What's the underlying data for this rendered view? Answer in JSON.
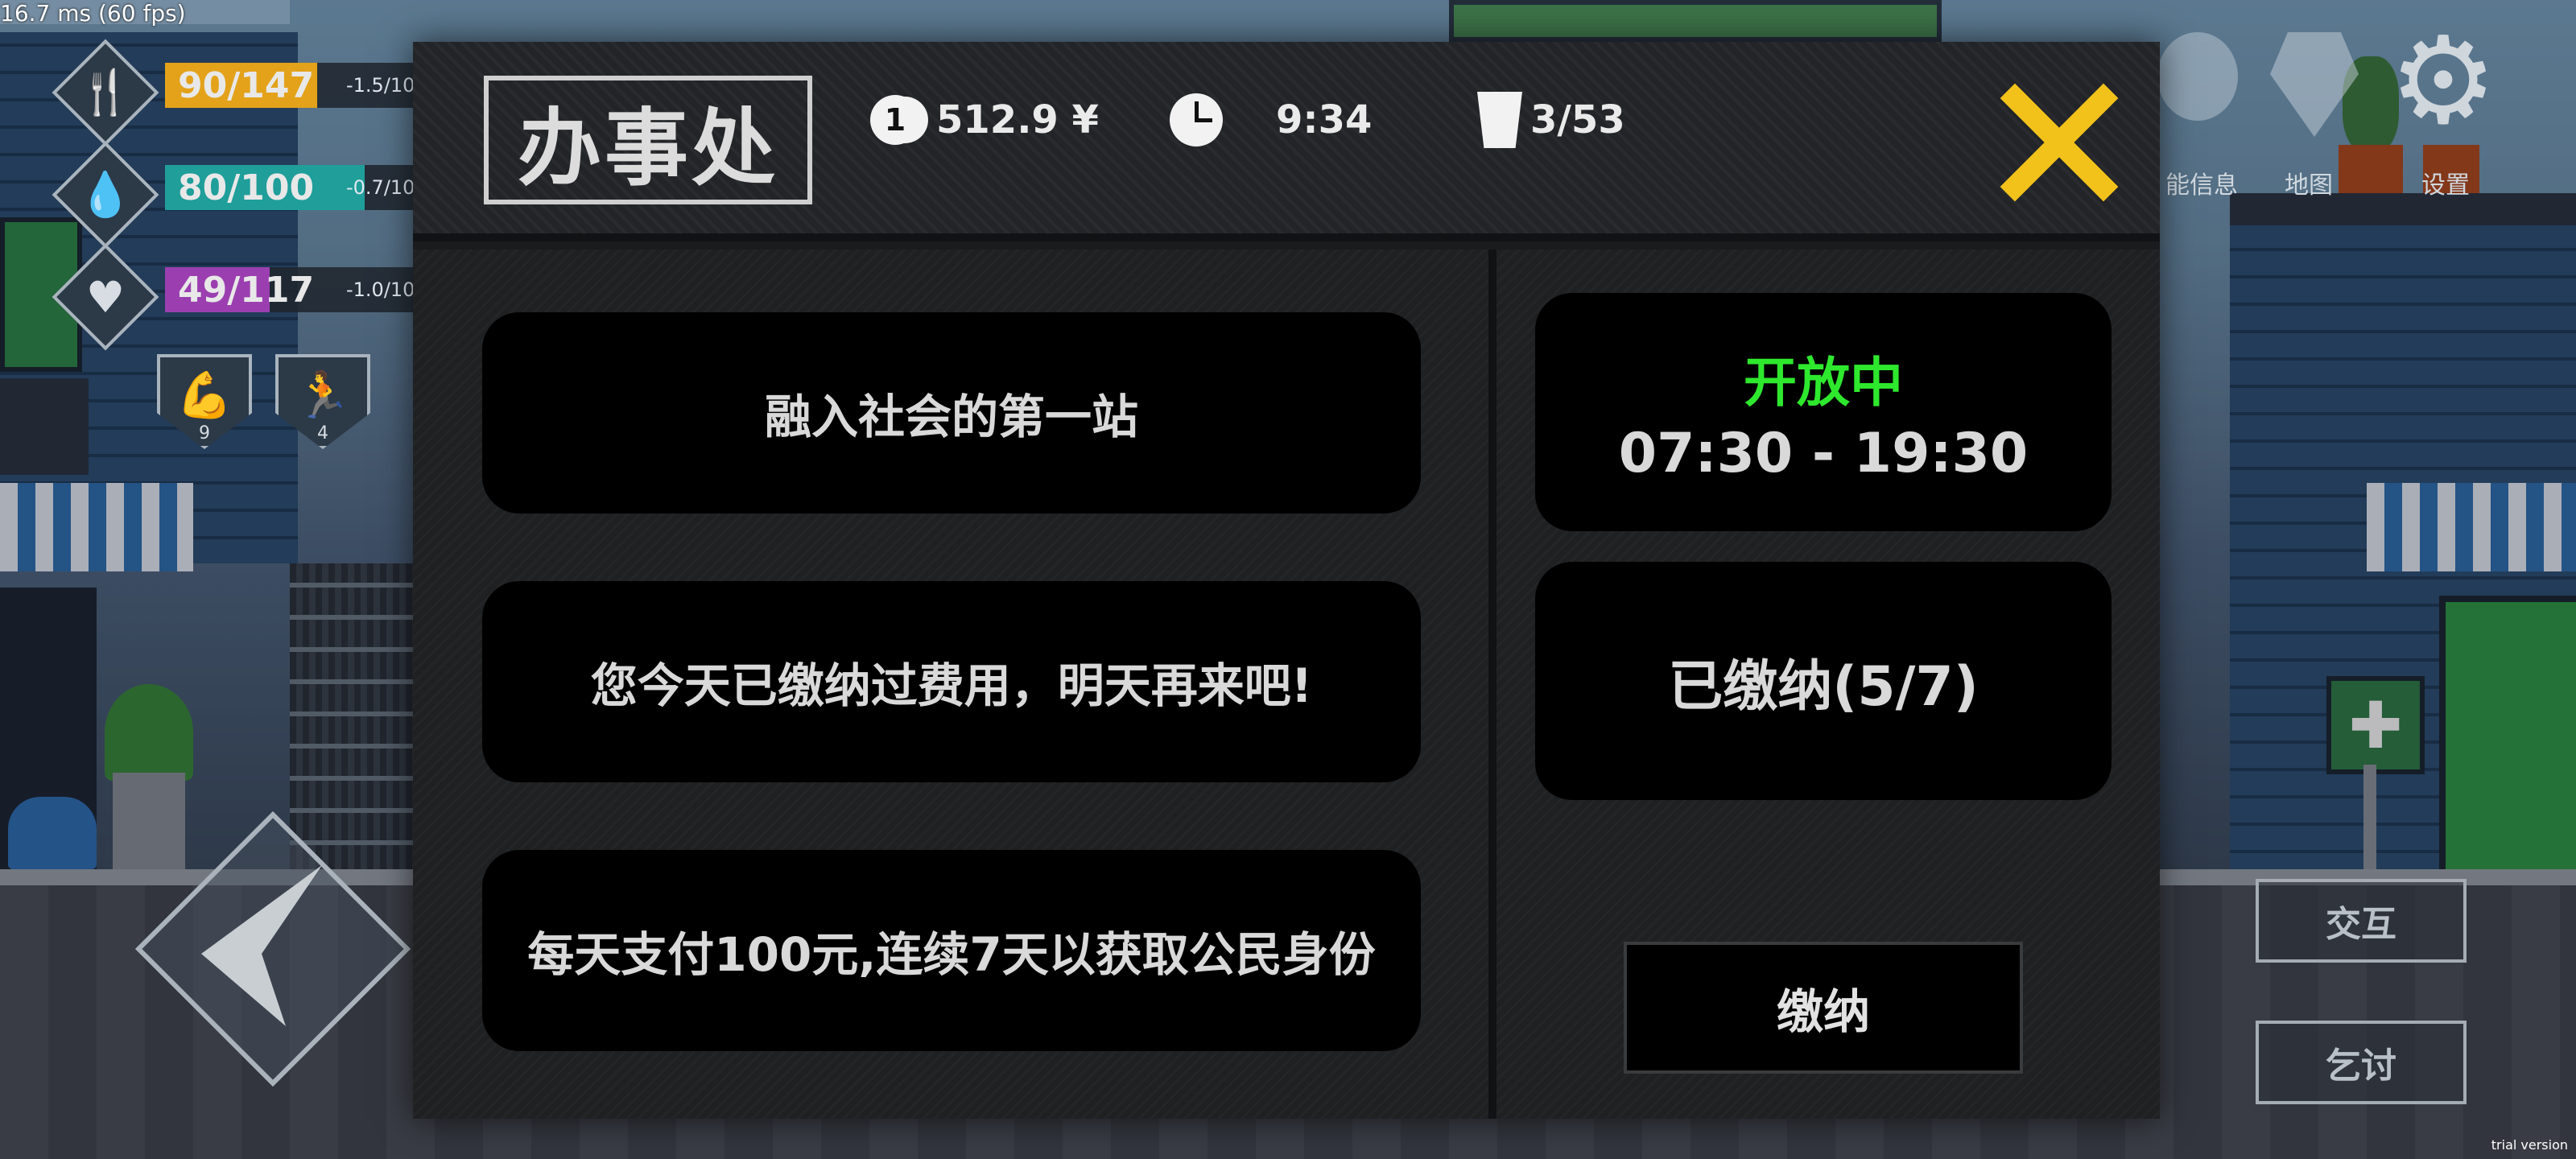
{
  "debug": {
    "fps_text": "16.7 ms (60 fps)",
    "watermark": "trial version"
  },
  "hud": {
    "stats": [
      {
        "icon": "fork-knife-icon",
        "value": "90/147",
        "rate": "-1.5/10",
        "color": "#e3a21a",
        "fill": 0.61
      },
      {
        "icon": "water-drop-icon",
        "value": "80/100",
        "rate": "-0.7/10",
        "color": "#1f9e9a",
        "fill": 0.8
      },
      {
        "icon": "heartbeat-icon",
        "value": "49/117",
        "rate": "-1.0/10",
        "color": "#9b3fb0",
        "fill": 0.42
      }
    ],
    "skills": [
      {
        "icon": "muscle-icon",
        "level": "9"
      },
      {
        "icon": "running-icon",
        "level": "4"
      }
    ],
    "top_menu": [
      {
        "icon": "character-info-icon",
        "label": "能信息"
      },
      {
        "icon": "map-icon",
        "label": "地图"
      },
      {
        "icon": "gear-icon",
        "label": "设置"
      }
    ],
    "side_buttons": {
      "interact": "交互",
      "beg": "乞讨"
    }
  },
  "modal": {
    "title": "办事处",
    "money": "512.9 ¥",
    "coin_symbol": "1",
    "time": "9:34",
    "capacity": "3/53",
    "info_lines": [
      "融入社会的第一站",
      "您今天已缴纳过费用，明天再来吧!",
      "每天支付100元,连续7天以获取公民身份"
    ],
    "status": {
      "state": "开放中",
      "hours": "07:30 - 19:30",
      "state_color": "#2ee82e"
    },
    "paid_progress": "已缴纳(5/7)",
    "pay_button": "缴纳",
    "close_color": "#f2c21b"
  }
}
